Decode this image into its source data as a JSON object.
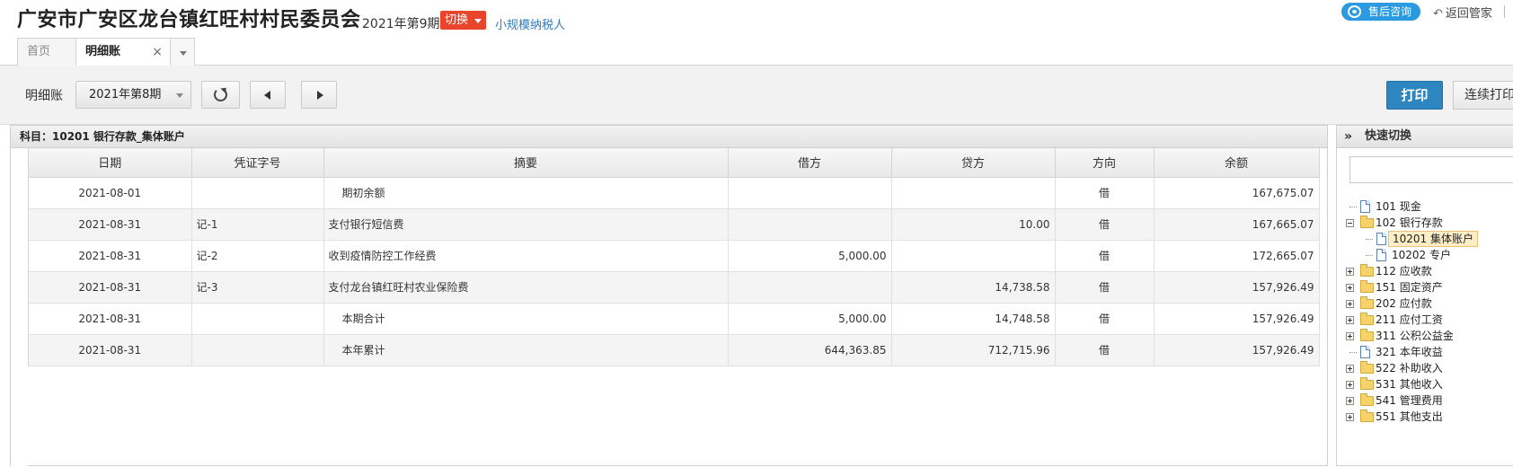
{
  "header": {
    "org_title": "广安市广安区龙台镇红旺村村民委员会",
    "period": "2021年第9期",
    "switch_label": "切换",
    "taxpayer_type": "小规模纳税人",
    "support_label": "售后咨询",
    "back_label": "返回管家"
  },
  "tabs": [
    {
      "label": "首页"
    },
    {
      "label": "明细账",
      "active": true
    }
  ],
  "toolbar": {
    "label": "明细账",
    "period_select": "2021年第8期",
    "print_label": "打印",
    "continuous_print_label": "连续打印"
  },
  "ledger": {
    "subject": "科目：10201  银行存款_集体账户",
    "columns": [
      "日期",
      "凭证字号",
      "摘要",
      "借方",
      "贷方",
      "方向",
      "余额"
    ],
    "rows": [
      {
        "date": "2021-08-01",
        "voucher": "",
        "summary": "期初余额",
        "debit": "",
        "credit": "",
        "direction": "借",
        "balance": "167,675.07",
        "indent": true
      },
      {
        "date": "2021-08-31",
        "voucher": "记-1",
        "summary": "支付银行短信费",
        "debit": "",
        "credit": "10.00",
        "direction": "借",
        "balance": "167,665.07",
        "indent": false
      },
      {
        "date": "2021-08-31",
        "voucher": "记-2",
        "summary": "收到疫情防控工作经费",
        "debit": "5,000.00",
        "credit": "",
        "direction": "借",
        "balance": "172,665.07",
        "indent": false
      },
      {
        "date": "2021-08-31",
        "voucher": "记-3",
        "summary": "支付龙台镇红旺村农业保险费",
        "debit": "",
        "credit": "14,738.58",
        "direction": "借",
        "balance": "157,926.49",
        "indent": false
      },
      {
        "date": "2021-08-31",
        "voucher": "",
        "summary": "本期合计",
        "debit": "5,000.00",
        "credit": "14,748.58",
        "direction": "借",
        "balance": "157,926.49",
        "indent": true
      },
      {
        "date": "2021-08-31",
        "voucher": "",
        "summary": "本年累计",
        "debit": "644,363.85",
        "credit": "712,715.96",
        "direction": "借",
        "balance": "157,926.49",
        "indent": true
      }
    ]
  },
  "quick_switch": {
    "title": "快速切换",
    "search_placeholder": "",
    "tree": [
      {
        "label": "101 现金",
        "kind": "doc",
        "level": 0,
        "expander": "none"
      },
      {
        "label": "102 银行存款",
        "kind": "folder",
        "level": 0,
        "expander": "minus"
      },
      {
        "label": "10201 集体账户",
        "kind": "doc",
        "level": 1,
        "expander": "none",
        "selected": true
      },
      {
        "label": "10202 专户",
        "kind": "doc",
        "level": 1,
        "expander": "none"
      },
      {
        "label": "112 应收款",
        "kind": "folder",
        "level": 0,
        "expander": "plus"
      },
      {
        "label": "151 固定资产",
        "kind": "folder",
        "level": 0,
        "expander": "plus"
      },
      {
        "label": "202 应付款",
        "kind": "folder",
        "level": 0,
        "expander": "plus"
      },
      {
        "label": "211 应付工资",
        "kind": "folder",
        "level": 0,
        "expander": "plus"
      },
      {
        "label": "311 公积公益金",
        "kind": "folder",
        "level": 0,
        "expander": "plus"
      },
      {
        "label": "321 本年收益",
        "kind": "doc",
        "level": 0,
        "expander": "none"
      },
      {
        "label": "522 补助收入",
        "kind": "folder",
        "level": 0,
        "expander": "plus"
      },
      {
        "label": "531 其他收入",
        "kind": "folder",
        "level": 0,
        "expander": "plus"
      },
      {
        "label": "541 管理费用",
        "kind": "folder",
        "level": 0,
        "expander": "plus"
      },
      {
        "label": "551 其他支出",
        "kind": "folder",
        "level": 0,
        "expander": "plus"
      }
    ]
  },
  "colors": {
    "accent_blue": "#2e86c1",
    "switch_red": "#e8452c",
    "support_blue": "#2b9ae0",
    "link_blue": "#2e7bbf"
  }
}
